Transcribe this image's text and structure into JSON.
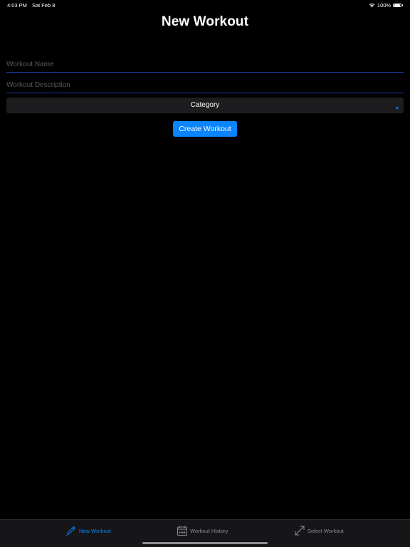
{
  "status_bar": {
    "time": "4:03 PM",
    "date": "Sat Feb 8",
    "battery": "100%",
    "battery_level": 1.0
  },
  "header": {
    "title": "New Workout"
  },
  "form": {
    "name_placeholder": "Workout Name",
    "name_value": "",
    "description_placeholder": "Workout Description",
    "description_value": "",
    "category_label": "Category",
    "create_label": "Create Workout"
  },
  "tab_bar": {
    "items": [
      {
        "label": "New Workout",
        "icon": "pencil-icon",
        "active": true
      },
      {
        "label": "Workout History",
        "icon": "calendar-icon",
        "active": false
      },
      {
        "label": "Select Workout",
        "icon": "expand-arrows-icon",
        "active": false
      }
    ]
  },
  "colors": {
    "accent": "#0a84ff",
    "background": "#000000",
    "input_underline": "#1a3ea6",
    "select_background": "#1d1d1f",
    "inactive_tab": "#8e8e93"
  }
}
